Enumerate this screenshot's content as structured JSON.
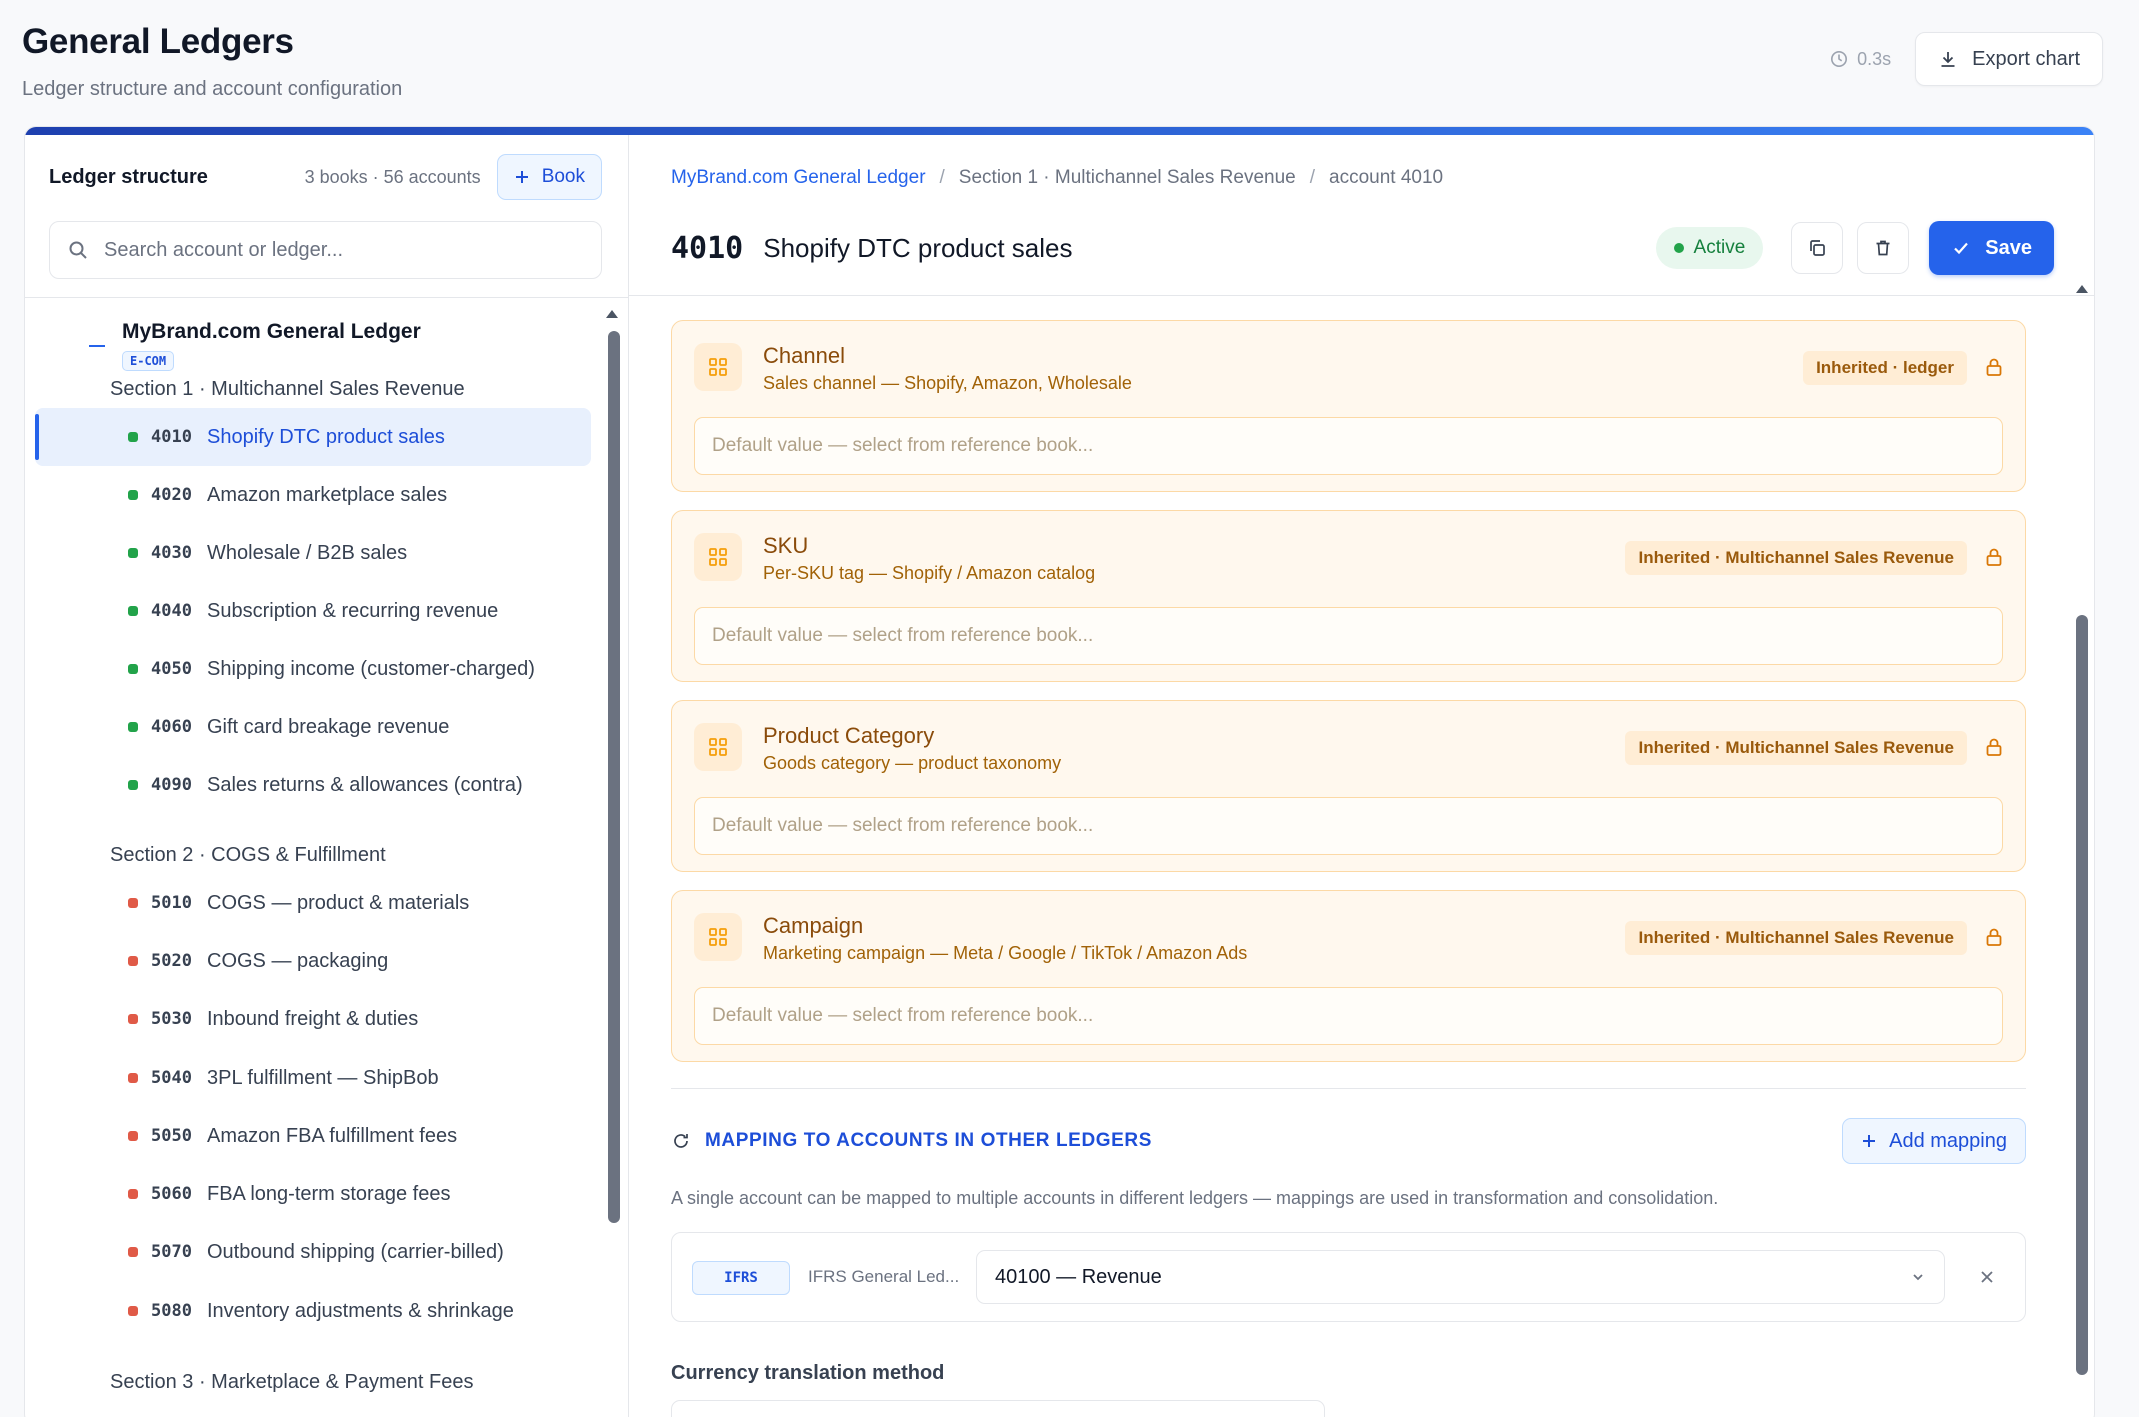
{
  "page": {
    "title": "General Ledgers",
    "subtitle": "Ledger structure and account configuration",
    "timing": "0.3s",
    "export_label": "Export chart"
  },
  "sidebar": {
    "title": "Ledger structure",
    "count": "3 books · 56 accounts",
    "book_button": "Book",
    "search_placeholder": "Search account or ledger...",
    "ledger": {
      "name": "MyBrand.com General Ledger",
      "tag": "E-COM"
    },
    "sections": [
      {
        "label": "Section 1 · Multichannel Sales Revenue"
      },
      {
        "label": "Section 2 · COGS & Fulfillment"
      },
      {
        "label": "Section 3 · Marketplace & Payment Fees"
      }
    ],
    "accounts": [
      {
        "code": "4010",
        "name": "Shopify DTC product sales",
        "type": "revenue"
      },
      {
        "code": "4020",
        "name": "Amazon marketplace sales",
        "type": "revenue"
      },
      {
        "code": "4030",
        "name": "Wholesale / B2B sales",
        "type": "revenue"
      },
      {
        "code": "4040",
        "name": "Subscription & recurring revenue",
        "type": "revenue"
      },
      {
        "code": "4050",
        "name": "Shipping income (customer-charged)",
        "type": "revenue"
      },
      {
        "code": "4060",
        "name": "Gift card breakage revenue",
        "type": "revenue"
      },
      {
        "code": "4090",
        "name": "Sales returns & allowances (contra)",
        "type": "revenue"
      },
      {
        "code": "5010",
        "name": "COGS — product & materials",
        "type": "expense"
      },
      {
        "code": "5020",
        "name": "COGS — packaging",
        "type": "expense"
      },
      {
        "code": "5030",
        "name": "Inbound freight & duties",
        "type": "expense"
      },
      {
        "code": "5040",
        "name": "3PL fulfillment — ShipBob",
        "type": "expense"
      },
      {
        "code": "5050",
        "name": "Amazon FBA fulfillment fees",
        "type": "expense"
      },
      {
        "code": "5060",
        "name": "FBA long-term storage fees",
        "type": "expense"
      },
      {
        "code": "5070",
        "name": "Outbound shipping (carrier-billed)",
        "type": "expense"
      },
      {
        "code": "5080",
        "name": "Inventory adjustments & shrinkage",
        "type": "expense"
      }
    ],
    "selected_code": "4010"
  },
  "detail": {
    "breadcrumb": [
      "MyBrand.com General Ledger",
      "Section 1 · Multichannel Sales Revenue",
      "account 4010"
    ],
    "code": "4010",
    "name": "Shopify DTC product sales",
    "status": "Active",
    "save_label": "Save",
    "analytics": [
      {
        "title": "Channel",
        "desc": "Sales channel — Shopify, Amazon, Wholesale",
        "badge": "Inherited · ledger",
        "placeholder": "Default value — select from reference book..."
      },
      {
        "title": "SKU",
        "desc": "Per-SKU tag — Shopify / Amazon catalog",
        "badge": "Inherited · Multichannel Sales Revenue",
        "placeholder": "Default value — select from reference book..."
      },
      {
        "title": "Product Category",
        "desc": "Goods category — product taxonomy",
        "badge": "Inherited · Multichannel Sales Revenue",
        "placeholder": "Default value — select from reference book..."
      },
      {
        "title": "Campaign",
        "desc": "Marketing campaign — Meta / Google / TikTok / Amazon Ads",
        "badge": "Inherited · Multichannel Sales Revenue",
        "placeholder": "Default value — select from reference book..."
      }
    ],
    "mapping": {
      "title": "MAPPING TO ACCOUNTS IN OTHER LEDGERS",
      "add_label": "Add mapping",
      "help": "A single account can be mapped to multiple accounts in different ledgers — mappings are used in transformation and consolidation.",
      "rows": [
        {
          "chip": "IFRS",
          "ledger": "IFRS General Led...",
          "account": "40100 — Revenue"
        }
      ]
    },
    "currency_label": "Currency translation method"
  },
  "colors": {
    "accent": "#2563eb",
    "revenue_dot": "#22a34a",
    "expense_dot": "#e05a47",
    "analytic_bg": "#fff8ee"
  }
}
